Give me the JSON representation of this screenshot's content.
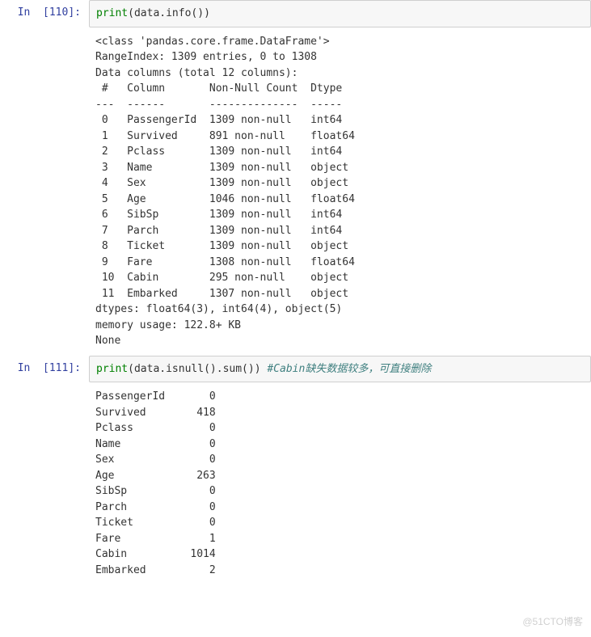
{
  "cells": [
    {
      "prompt": "In  [110]:",
      "code_html": "<span class='kw'>print</span><span class='punc'>(</span>data<span class='punc'>.</span>info<span class='punc'>())</span>",
      "output": "<class 'pandas.core.frame.DataFrame'>\nRangeIndex: 1309 entries, 0 to 1308\nData columns (total 12 columns):\n #   Column       Non-Null Count  Dtype  \n---  ------       --------------  -----  \n 0   PassengerId  1309 non-null   int64  \n 1   Survived     891 non-null    float64\n 2   Pclass       1309 non-null   int64  \n 3   Name         1309 non-null   object \n 4   Sex          1309 non-null   object \n 5   Age          1046 non-null   float64\n 6   SibSp        1309 non-null   int64  \n 7   Parch        1309 non-null   int64  \n 8   Ticket       1309 non-null   object \n 9   Fare         1308 non-null   float64\n 10  Cabin        295 non-null    object \n 11  Embarked     1307 non-null   object \ndtypes: float64(3), int64(4), object(5)\nmemory usage: 122.8+ KB\nNone"
    },
    {
      "prompt": "In  [111]:",
      "code_html": "<span class='kw'>print</span><span class='punc'>(</span>data<span class='punc'>.</span>isnull<span class='punc'>().</span>sum<span class='punc'>())</span> <span class='comment'>#Cabin缺失数据较多，可直接删除</span>",
      "output": "PassengerId       0\nSurvived        418\nPclass            0\nName              0\nSex               0\nAge             263\nSibSp             0\nParch             0\nTicket            0\nFare              1\nCabin          1014\nEmbarked          2"
    }
  ],
  "watermark": "@51CTO博客",
  "chart_data": {
    "type": "table",
    "info_table": {
      "title": "DataFrame Info",
      "range_index": "1309 entries, 0 to 1308",
      "total_columns": 12,
      "columns": [
        "#",
        "Column",
        "Non-Null Count",
        "Dtype"
      ],
      "rows": [
        [
          0,
          "PassengerId",
          "1309 non-null",
          "int64"
        ],
        [
          1,
          "Survived",
          "891 non-null",
          "float64"
        ],
        [
          2,
          "Pclass",
          "1309 non-null",
          "int64"
        ],
        [
          3,
          "Name",
          "1309 non-null",
          "object"
        ],
        [
          4,
          "Sex",
          "1309 non-null",
          "object"
        ],
        [
          5,
          "Age",
          "1046 non-null",
          "float64"
        ],
        [
          6,
          "SibSp",
          "1309 non-null",
          "int64"
        ],
        [
          7,
          "Parch",
          "1309 non-null",
          "int64"
        ],
        [
          8,
          "Ticket",
          "1309 non-null",
          "object"
        ],
        [
          9,
          "Fare",
          "1308 non-null",
          "float64"
        ],
        [
          10,
          "Cabin",
          "295 non-null",
          "object"
        ],
        [
          11,
          "Embarked",
          "1307 non-null",
          "object"
        ]
      ],
      "dtypes_summary": "float64(3), int64(4), object(5)",
      "memory_usage": "122.8+ KB"
    },
    "null_counts": {
      "PassengerId": 0,
      "Survived": 418,
      "Pclass": 0,
      "Name": 0,
      "Sex": 0,
      "Age": 263,
      "SibSp": 0,
      "Parch": 0,
      "Ticket": 0,
      "Fare": 1,
      "Cabin": 1014,
      "Embarked": 2
    }
  }
}
